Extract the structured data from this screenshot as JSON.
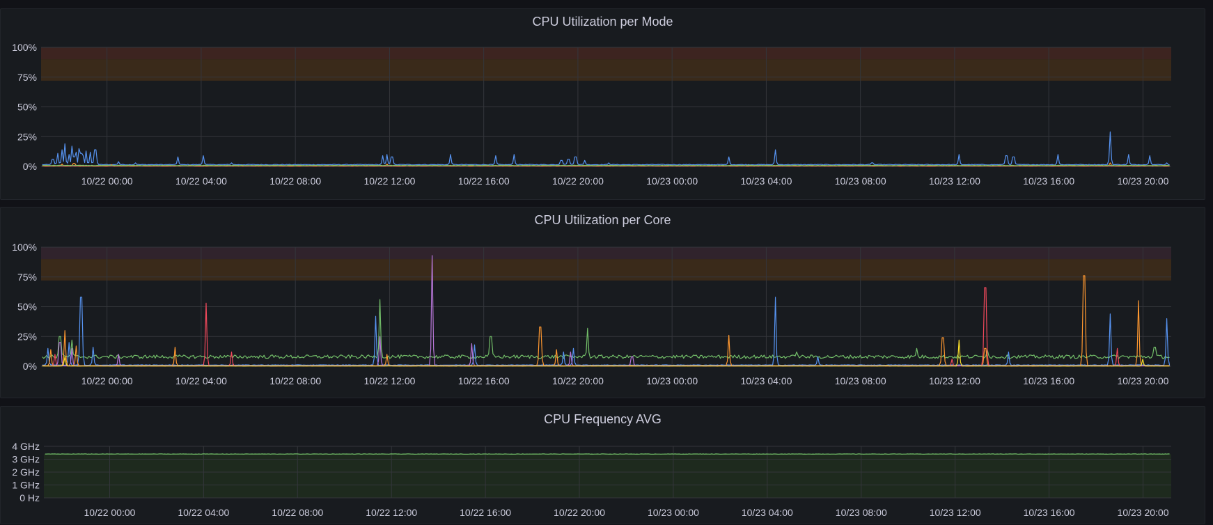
{
  "colors": {
    "background": "#181b1f",
    "grid": "#34363b",
    "threshold_warn": "#3a2a1a",
    "threshold_crit": "#3d2420",
    "text": "#ccccdc"
  },
  "x_axis": {
    "ticks": [
      "10/22 00:00",
      "10/22 04:00",
      "10/22 08:00",
      "10/22 12:00",
      "10/22 16:00",
      "10/22 20:00",
      "10/23 00:00",
      "10/23 04:00",
      "10/23 08:00",
      "10/23 12:00",
      "10/23 16:00",
      "10/23 20:00"
    ]
  },
  "chart_data": [
    {
      "type": "line",
      "title": "CPU Utilization per Mode",
      "y_ticks": [
        "100%",
        "75%",
        "50%",
        "25%",
        "0%"
      ],
      "ylim": [
        0,
        100
      ],
      "xlim_hours": [
        -2.8,
        45.2
      ],
      "thresholds": [
        {
          "from": 72,
          "to": 90,
          "color": "#3a2a1a"
        },
        {
          "from": 90,
          "to": 100,
          "color": "#3d2420"
        }
      ],
      "grid": true,
      "series": [
        {
          "color": "#5794f2",
          "baseline": 1.5,
          "spikes": [
            [
              -2.3,
              6
            ],
            [
              -2.1,
              11
            ],
            [
              -1.9,
              14
            ],
            [
              -1.8,
              19
            ],
            [
              -1.6,
              10
            ],
            [
              -1.5,
              17
            ],
            [
              -1.3,
              12
            ],
            [
              -1.2,
              15
            ],
            [
              -1.0,
              9
            ],
            [
              -0.9,
              13
            ],
            [
              -0.7,
              12
            ],
            [
              -0.5,
              14
            ],
            [
              -1.4,
              8
            ],
            [
              -1.1,
              11
            ],
            [
              0.5,
              4
            ],
            [
              1.2,
              3
            ],
            [
              3.0,
              8
            ],
            [
              4.1,
              9
            ],
            [
              5.3,
              3
            ],
            [
              11.7,
              9
            ],
            [
              11.9,
              10
            ],
            [
              12.1,
              8
            ],
            [
              14.6,
              10
            ],
            [
              16.5,
              9
            ],
            [
              17.3,
              10
            ],
            [
              19.3,
              5
            ],
            [
              19.6,
              6
            ],
            [
              19.9,
              8
            ],
            [
              20.3,
              5
            ],
            [
              21.3,
              3
            ],
            [
              26.4,
              8
            ],
            [
              28.4,
              14
            ],
            [
              32.5,
              3
            ],
            [
              36.2,
              10
            ],
            [
              38.2,
              9
            ],
            [
              38.5,
              8
            ],
            [
              40.4,
              10
            ],
            [
              42.6,
              29
            ],
            [
              43.4,
              10
            ],
            [
              44.3,
              9
            ],
            [
              45.0,
              3
            ]
          ]
        },
        {
          "color": "#f2495c",
          "baseline": 0.3,
          "spikes": []
        },
        {
          "color": "#ff9830",
          "baseline": 0.5,
          "spikes": [
            [
              -1.9,
              2
            ],
            [
              -1.4,
              2.5
            ],
            [
              0.2,
              1.5
            ],
            [
              11.9,
              2
            ],
            [
              42.6,
              3
            ]
          ]
        },
        {
          "color": "#73bf69",
          "baseline": 0.8,
          "spikes": []
        }
      ]
    },
    {
      "type": "line",
      "title": "CPU Utilization per Core",
      "y_ticks": [
        "100%",
        "75%",
        "50%",
        "25%",
        "0%"
      ],
      "ylim": [
        0,
        100
      ],
      "xlim_hours": [
        -2.8,
        45.2
      ],
      "thresholds": [
        {
          "from": 72,
          "to": 90,
          "color": "#3a2a1a"
        },
        {
          "from": 90,
          "to": 100,
          "color": "#30232c"
        }
      ],
      "grid": true,
      "series": [
        {
          "color": "#73bf69",
          "baseline": 8,
          "noise": 3,
          "spikes": [
            [
              -2.0,
              25
            ],
            [
              -1.5,
              22
            ],
            [
              11.6,
              56
            ],
            [
              16.3,
              25
            ],
            [
              20.4,
              32
            ],
            [
              29.3,
              12
            ],
            [
              34.4,
              15
            ],
            [
              37.4,
              14
            ],
            [
              44.5,
              16
            ]
          ]
        },
        {
          "color": "#5794f2",
          "baseline": 1,
          "spikes": [
            [
              -2.5,
              15
            ],
            [
              -1.6,
              20
            ],
            [
              -1.1,
              58
            ],
            [
              -0.6,
              16
            ],
            [
              11.4,
              42
            ],
            [
              15.6,
              18
            ],
            [
              19.4,
              12
            ],
            [
              19.8,
              15
            ],
            [
              28.4,
              58
            ],
            [
              30.2,
              8
            ],
            [
              38.3,
              12
            ],
            [
              42.6,
              44
            ],
            [
              45.0,
              40
            ]
          ]
        },
        {
          "color": "#ff9830",
          "baseline": 0.5,
          "spikes": [
            [
              -2.4,
              14
            ],
            [
              -1.8,
              30
            ],
            [
              -1.3,
              17
            ],
            [
              2.9,
              16
            ],
            [
              11.9,
              10
            ],
            [
              18.4,
              33
            ],
            [
              19.1,
              14
            ],
            [
              26.4,
              26
            ],
            [
              35.5,
              24
            ],
            [
              37.3,
              15
            ],
            [
              41.5,
              76
            ],
            [
              43.8,
              55
            ]
          ]
        },
        {
          "color": "#f2495c",
          "baseline": 0.3,
          "spikes": [
            [
              -2.2,
              10
            ],
            [
              4.2,
              53
            ],
            [
              5.3,
              12
            ],
            [
              35.9,
              6
            ],
            [
              37.3,
              66
            ],
            [
              42.9,
              15
            ]
          ]
        },
        {
          "color": "#b877d9",
          "baseline": 0.4,
          "spikes": [
            [
              -2.0,
              20
            ],
            [
              -1.5,
              15
            ],
            [
              0.5,
              10
            ],
            [
              11.6,
              25
            ],
            [
              13.8,
              93
            ],
            [
              15.5,
              19
            ],
            [
              19.7,
              12
            ],
            [
              22.3,
              8
            ]
          ]
        },
        {
          "color": "#fade2a",
          "baseline": 0.2,
          "spikes": [
            [
              -1.8,
              8
            ],
            [
              36.2,
              22
            ],
            [
              44.0,
              6
            ]
          ]
        }
      ]
    },
    {
      "type": "line",
      "title": "CPU Frequency AVG",
      "y_ticks": [
        "4 GHz",
        "3 GHz",
        "2 GHz",
        "1 GHz",
        "0 Hz"
      ],
      "ylim": [
        0,
        4
      ],
      "xlim_hours": [
        -2.8,
        45.2
      ],
      "thresholds": [],
      "grid": true,
      "fill": "#1e2a1e",
      "series": [
        {
          "color": "#73bf69",
          "baseline": 3.4,
          "spikes": []
        }
      ]
    }
  ]
}
